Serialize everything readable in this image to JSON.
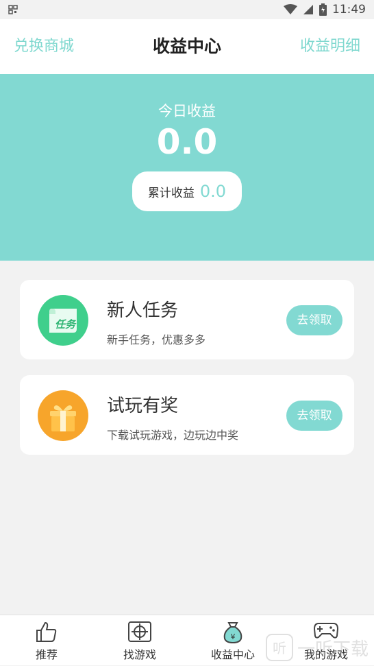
{
  "status": {
    "time": "11:49"
  },
  "header": {
    "left_link": "兑换商城",
    "title": "收益中心",
    "right_link": "收益明细"
  },
  "summary": {
    "today_label": "今日收益",
    "today_value": "0.0",
    "total_label": "累计收益",
    "total_value": "0.0"
  },
  "tasks": [
    {
      "title": "新人任务",
      "subtitle": "新手任务，优惠多多",
      "button": "去领取",
      "icon_text": "任务",
      "icon": "task-scroll-icon"
    },
    {
      "title": "试玩有奖",
      "subtitle": "下载试玩游戏，边玩边中奖",
      "button": "去领取",
      "icon": "gift-icon"
    }
  ],
  "tabbar": {
    "items": [
      {
        "label": "推荐",
        "icon": "thumbs-up-icon"
      },
      {
        "label": "找游戏",
        "icon": "crosshair-icon"
      },
      {
        "label": "收益中心",
        "icon": "money-bag-icon",
        "icon_text": "¥"
      },
      {
        "label": "我的游戏",
        "icon": "gamepad-icon"
      }
    ]
  },
  "watermark": {
    "text": "一听下载"
  },
  "colors": {
    "accent": "#82d9d2",
    "task_green": "#3fcf8c",
    "gift_orange": "#f5a623"
  }
}
